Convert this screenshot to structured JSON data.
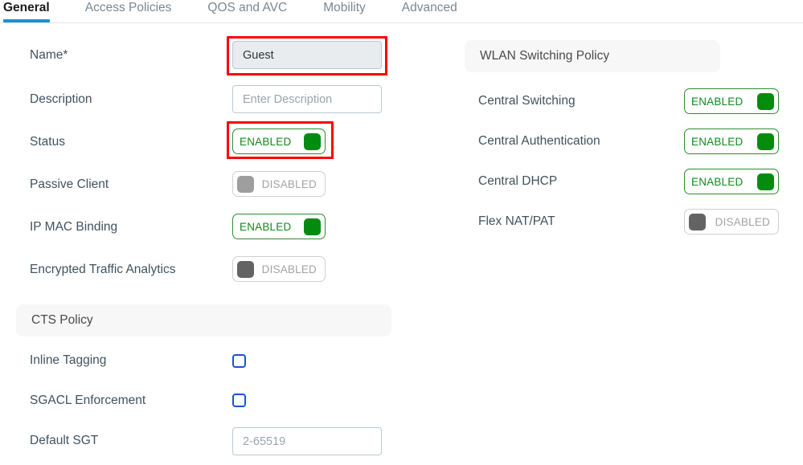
{
  "tabs": [
    {
      "label": "General",
      "active": true
    },
    {
      "label": "Access Policies",
      "active": false
    },
    {
      "label": "QOS and AVC",
      "active": false
    },
    {
      "label": "Mobility",
      "active": false
    },
    {
      "label": "Advanced",
      "active": false
    }
  ],
  "left": {
    "name": {
      "label": "Name*",
      "value": "Guest",
      "highlighted": true
    },
    "description": {
      "label": "Description",
      "value": "",
      "placeholder": "Enter Description"
    },
    "status": {
      "label": "Status",
      "state": "ENABLED",
      "highlighted": true
    },
    "passive_client": {
      "label": "Passive Client",
      "state": "DISABLED"
    },
    "ip_mac_binding": {
      "label": "IP MAC Binding",
      "state": "ENABLED"
    },
    "encrypted_traffic_analytics": {
      "label": "Encrypted Traffic Analytics",
      "state": "DISABLED"
    },
    "cts_policy": {
      "header": "CTS Policy",
      "inline_tagging": {
        "label": "Inline Tagging",
        "checked": false
      },
      "sgacl_enforcement": {
        "label": "SGACL Enforcement",
        "checked": false
      },
      "default_sgt": {
        "label": "Default SGT",
        "value": "",
        "placeholder": "2-65519"
      }
    }
  },
  "right": {
    "header": "WLAN Switching Policy",
    "central_switching": {
      "label": "Central Switching",
      "state": "ENABLED"
    },
    "central_authentication": {
      "label": "Central Authentication",
      "state": "ENABLED"
    },
    "central_dhcp": {
      "label": "Central DHCP",
      "state": "ENABLED"
    },
    "flex_nat_pat": {
      "label": "Flex NAT/PAT",
      "state": "DISABLED"
    }
  },
  "colors": {
    "accent_blue": "#1593d8",
    "enabled_green": "#038c10",
    "disabled_gray": "#9e9e9e",
    "disabled_gray_dark": "#636363",
    "checkbox_blue": "#1a53d0",
    "highlight_red": "#ff0000",
    "label_text": "#41525e",
    "section_bg": "#f7f7f8"
  }
}
